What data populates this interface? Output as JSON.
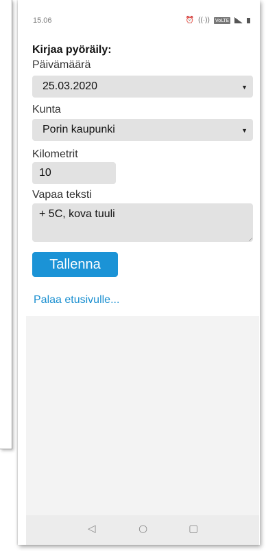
{
  "status_bar": {
    "time": "15.06",
    "icons": [
      "alarm-icon",
      "hotspot-icon",
      "volte-icon",
      "signal-icon",
      "battery-icon"
    ],
    "volte_label": "VoLTE"
  },
  "form": {
    "title": "Kirjaa pyöräily:",
    "date_label": "Päivämäärä",
    "date_value": "25.03.2020",
    "municipality_label": "Kunta",
    "municipality_value": "Porin kaupunki",
    "km_label": "Kilometrit",
    "km_value": "10",
    "free_text_label": "Vapaa teksti",
    "free_text_value": "+ 5C, kova tuuli",
    "save_label": "Tallenna",
    "back_link": "Palaa etusivulle..."
  },
  "nav": {
    "back_glyph": "◁",
    "home_glyph": "○",
    "recents_glyph": "▢"
  },
  "colors": {
    "primary": "#1b93d6",
    "link": "#1a8fd0",
    "field_bg": "#e2e2e2"
  }
}
